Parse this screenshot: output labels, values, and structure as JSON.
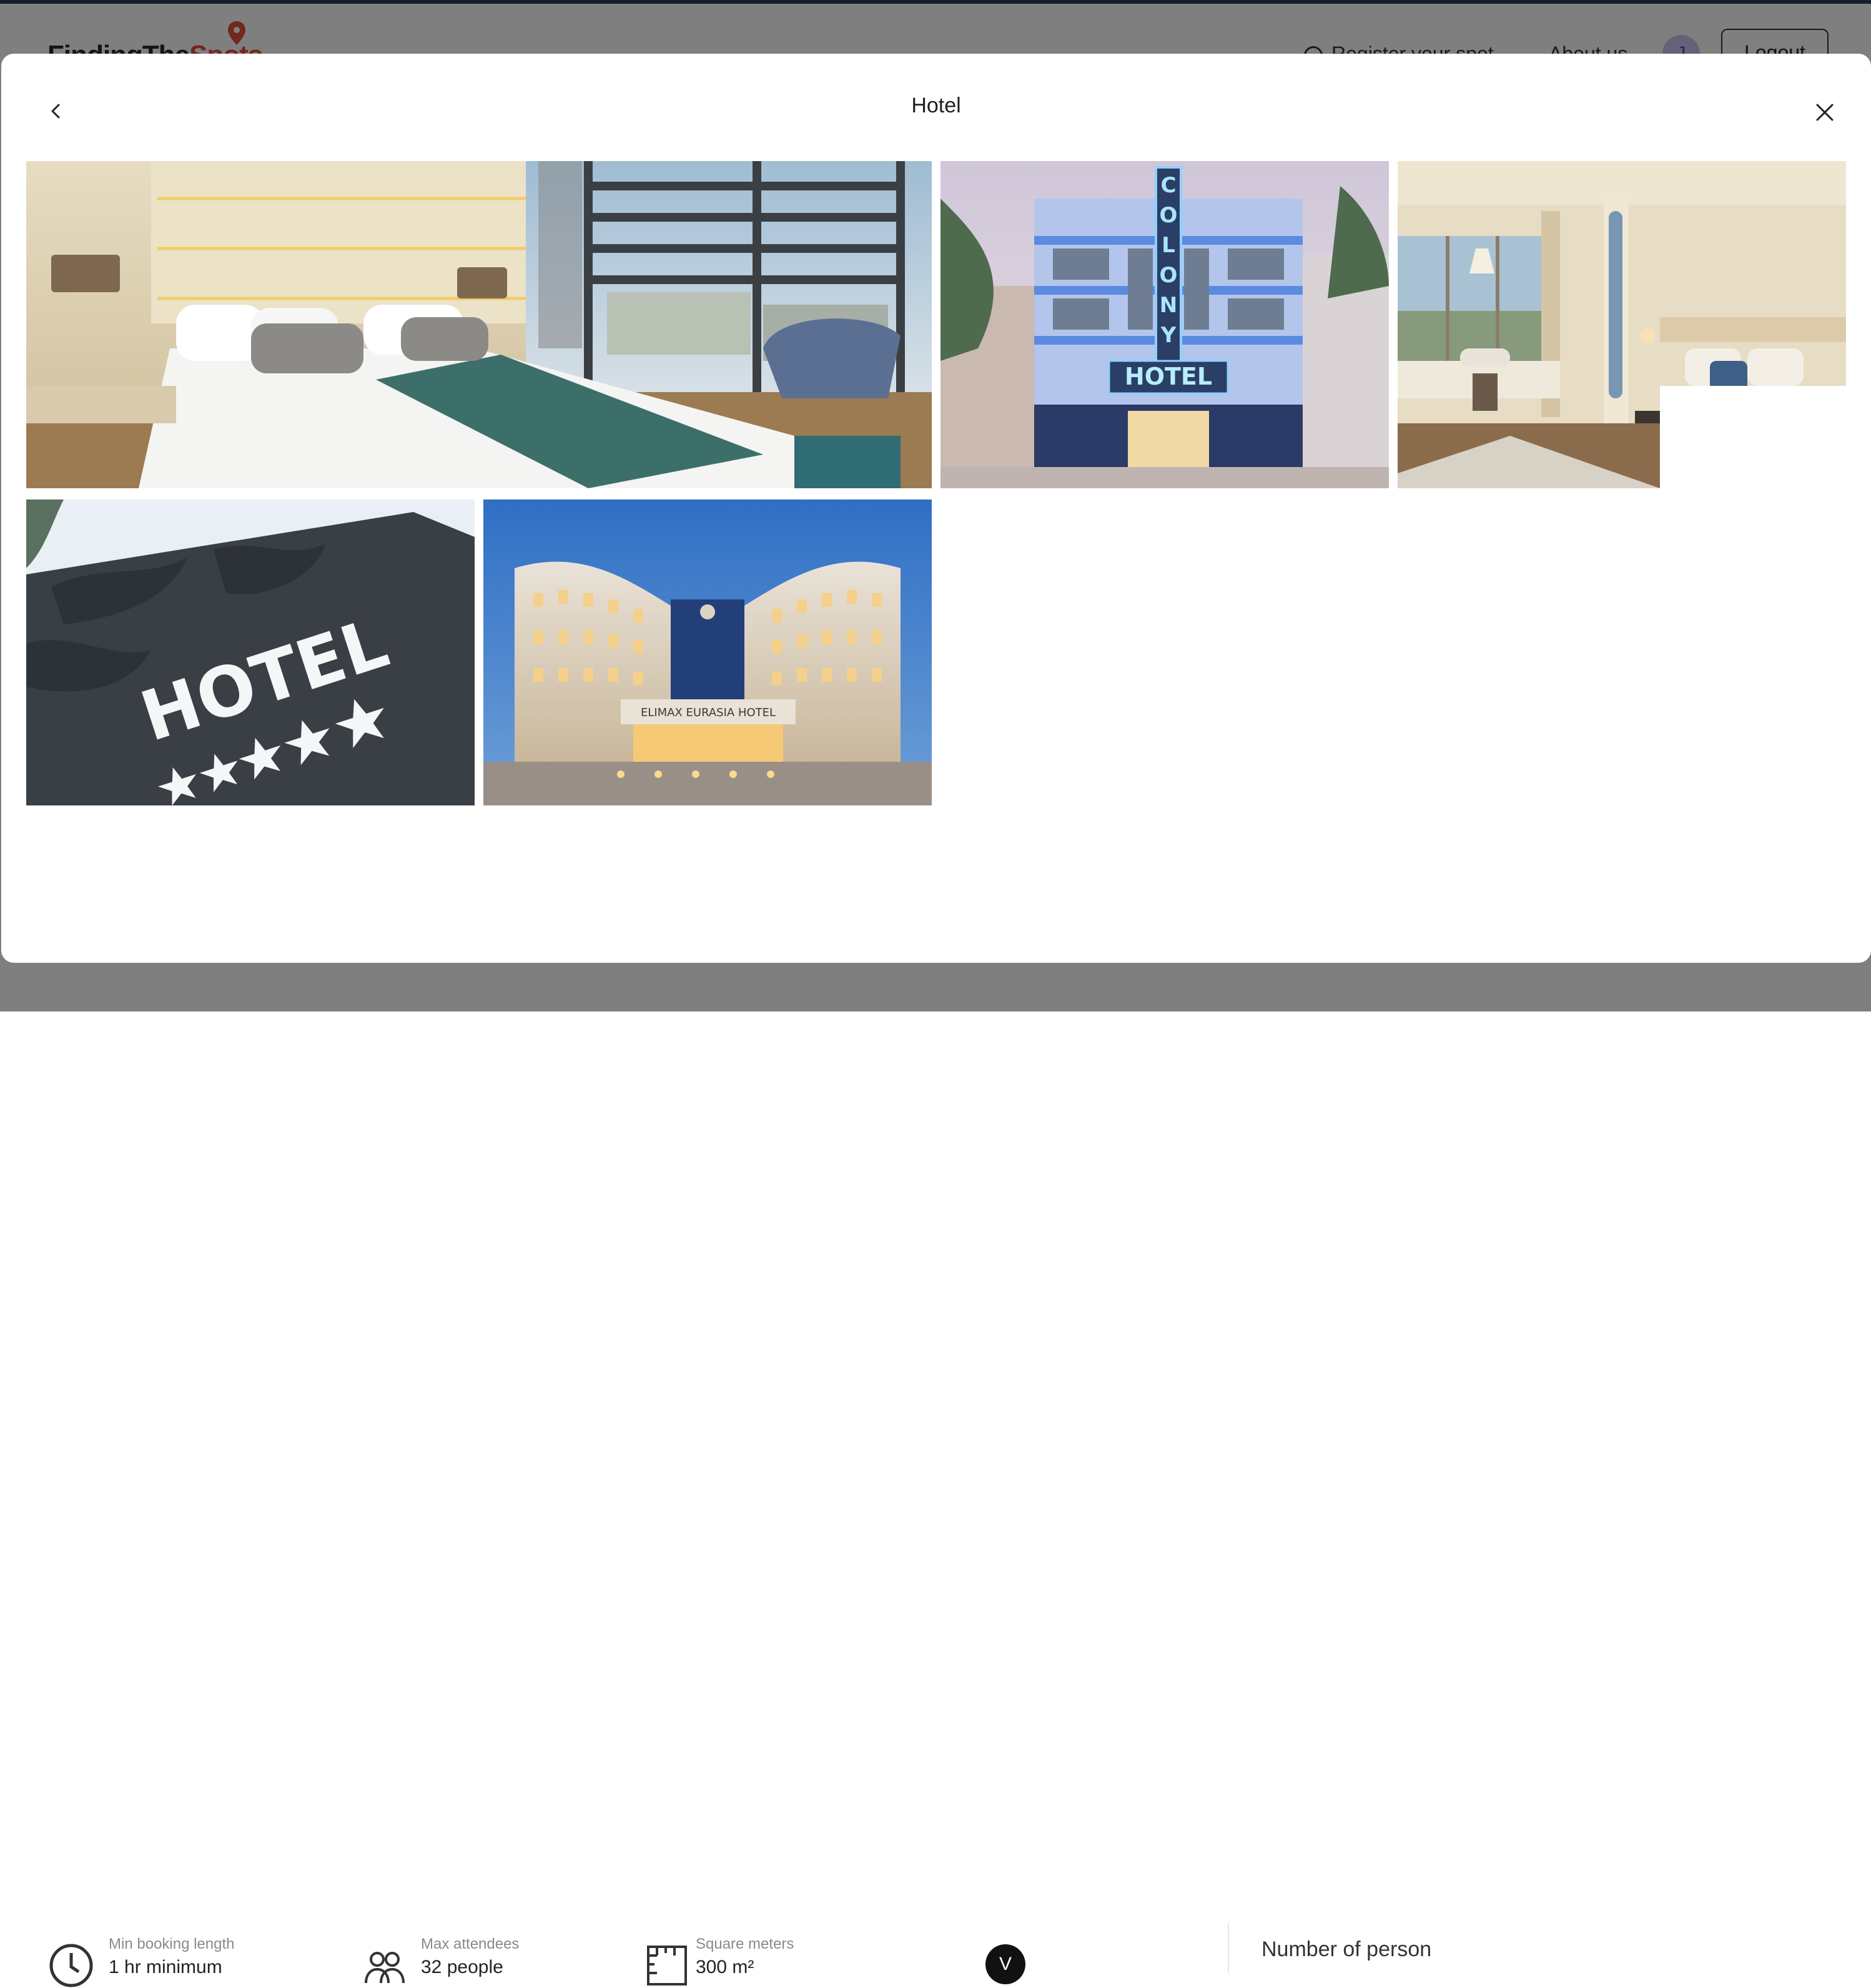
{
  "background": {
    "logo": {
      "text_main": "FindingThe",
      "text_accent": "Spots"
    },
    "nav": {
      "register": "Register your spot",
      "about": "About us",
      "avatar_initial": "J",
      "logout": "Logout"
    },
    "stats": [
      {
        "label": "Min booking length",
        "value": "1 hr minimum"
      },
      {
        "label": "Max attendees",
        "value": "32 people"
      },
      {
        "label": "Square meters",
        "value": "300 m²"
      }
    ],
    "scroll_glyph": "V",
    "booking": {
      "number_of_person": "Number of person"
    }
  },
  "modal": {
    "title": "Hotel",
    "photos": [
      {
        "name": "hotel-bedroom-photo",
        "alt": "Hotel bedroom with teal bed runner and city view"
      },
      {
        "name": "colony-hotel-facade-photo",
        "alt": "Colony Hotel art deco facade at dusk"
      },
      {
        "name": "hotel-suite-photo",
        "alt": "Bright hotel suite with ocean view"
      },
      {
        "name": "hotel-sign-photo",
        "alt": "Five star hotel sign on dark wall"
      },
      {
        "name": "eurasia-hotel-photo",
        "alt": "Eurasia hotel building lit at night"
      }
    ],
    "sign_text": "HOTEL",
    "colony_letters": "COLONY",
    "colony_hotel": "HOTEL",
    "eurasia_sign": "ELIMAX EURASIA HOTEL"
  },
  "icons": {
    "back": "chevron-left-icon",
    "close": "close-icon"
  }
}
